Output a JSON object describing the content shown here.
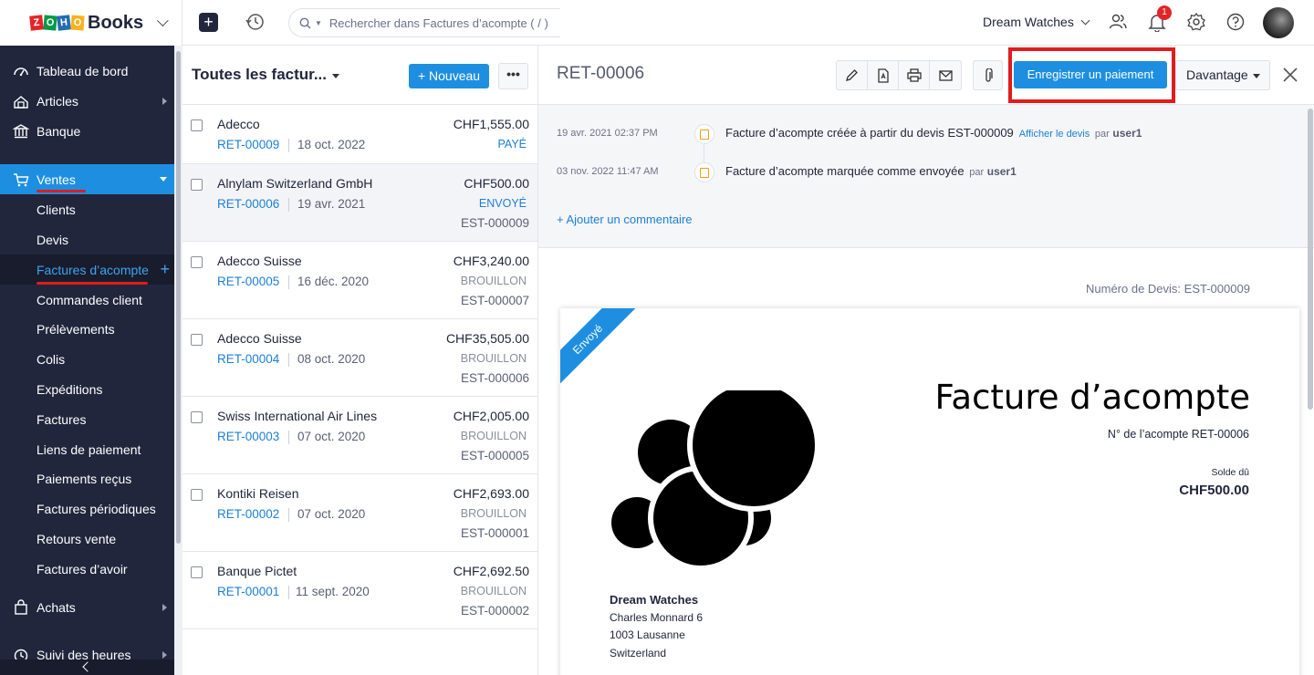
{
  "brand": {
    "zoho_letters": [
      "Z",
      "O",
      "H",
      "O"
    ],
    "name": "Books"
  },
  "topbar": {
    "quick_add": "+",
    "search_placeholder": "Rechercher dans Factures d’acompte ( / )",
    "org_name": "Dream Watches",
    "notification_count": "1"
  },
  "sidebar": {
    "items": [
      {
        "label": "Tableau de bord",
        "icon": "dashboard-icon"
      },
      {
        "label": "Articles",
        "icon": "tag-icon"
      },
      {
        "label": "Banque",
        "icon": "bank-icon"
      },
      {
        "label": "Ventes",
        "icon": "cart-icon"
      },
      {
        "label": "Achats",
        "icon": "bag-icon"
      },
      {
        "label": "Suivi des heures",
        "icon": "clock-icon"
      }
    ],
    "sales_sub": [
      "Clients",
      "Devis",
      "Factures d’acompte",
      "Commandes client",
      "Prélèvements",
      "Colis",
      "Expéditions",
      "Factures",
      "Liens de paiement",
      "Paiements reçus",
      "Factures périodiques",
      "Retours vente",
      "Factures d’avoir"
    ]
  },
  "list": {
    "title": "Toutes les factur...",
    "new_label": "Nouveau",
    "more_label": "•••",
    "rows": [
      {
        "customer": "Adecco",
        "number": "RET-00009",
        "date": "18 oct. 2022",
        "amount": "CHF1,555.00",
        "status": "PAYÉ",
        "ref": ""
      },
      {
        "customer": "Alnylam Switzerland GmbH",
        "number": "RET-00006",
        "date": "19 avr. 2021",
        "amount": "CHF500.00",
        "status": "ENVOYÉ",
        "ref": "EST-000009"
      },
      {
        "customer": "Adecco Suisse",
        "number": "RET-00005",
        "date": "16 déc. 2020",
        "amount": "CHF3,240.00",
        "status": "BROUILLON",
        "ref": "EST-000007"
      },
      {
        "customer": "Adecco Suisse",
        "number": "RET-00004",
        "date": "08 oct. 2020",
        "amount": "CHF35,505.00",
        "status": "BROUILLON",
        "ref": "EST-000006"
      },
      {
        "customer": "Swiss International Air Lines",
        "number": "RET-00003",
        "date": "07 oct. 2020",
        "amount": "CHF2,005.00",
        "status": "BROUILLON",
        "ref": "EST-000005"
      },
      {
        "customer": "Kontiki Reisen",
        "number": "RET-00002",
        "date": "07 oct. 2020",
        "amount": "CHF2,693.00",
        "status": "BROUILLON",
        "ref": "EST-000001"
      },
      {
        "customer": "Banque Pictet",
        "number": "RET-00001",
        "date": "11 sept. 2020",
        "amount": "CHF2,692.50",
        "status": "BROUILLON",
        "ref": "EST-000002"
      }
    ]
  },
  "detail": {
    "title": "RET-00006",
    "record_payment": "Enregistrer un paiement",
    "more_label": "Davantage",
    "activity": [
      {
        "time": "19 avr. 2021 02:37 PM",
        "text": "Facture d’acompte créée à partir du devis EST-000009",
        "link": "Afficher le devis",
        "by": "par",
        "user": "user1"
      },
      {
        "time": "03 nov. 2022 11:47 AM",
        "text": "Facture d’acompte marquée comme envoyée",
        "link": "",
        "by": "par",
        "user": "user1"
      }
    ],
    "add_comment": "+ Ajouter un commentaire",
    "quote_number": "Numéro de Devis: EST-000009",
    "document": {
      "ribbon": "Envoyé",
      "title": "Facture d’acompte",
      "retainer_number": "N° de l’acompte RET-00006",
      "balance_label": "Solde dû",
      "balance": "CHF500.00",
      "org_name": "Dream Watches",
      "address": [
        "Charles Monnard 6",
        "1003 Lausanne",
        "Switzerland"
      ]
    }
  },
  "colors": {
    "accent": "#1e8fe0",
    "sidebar": "#21263c",
    "highlight": "#e01c1c",
    "link": "#1c7fd6"
  }
}
